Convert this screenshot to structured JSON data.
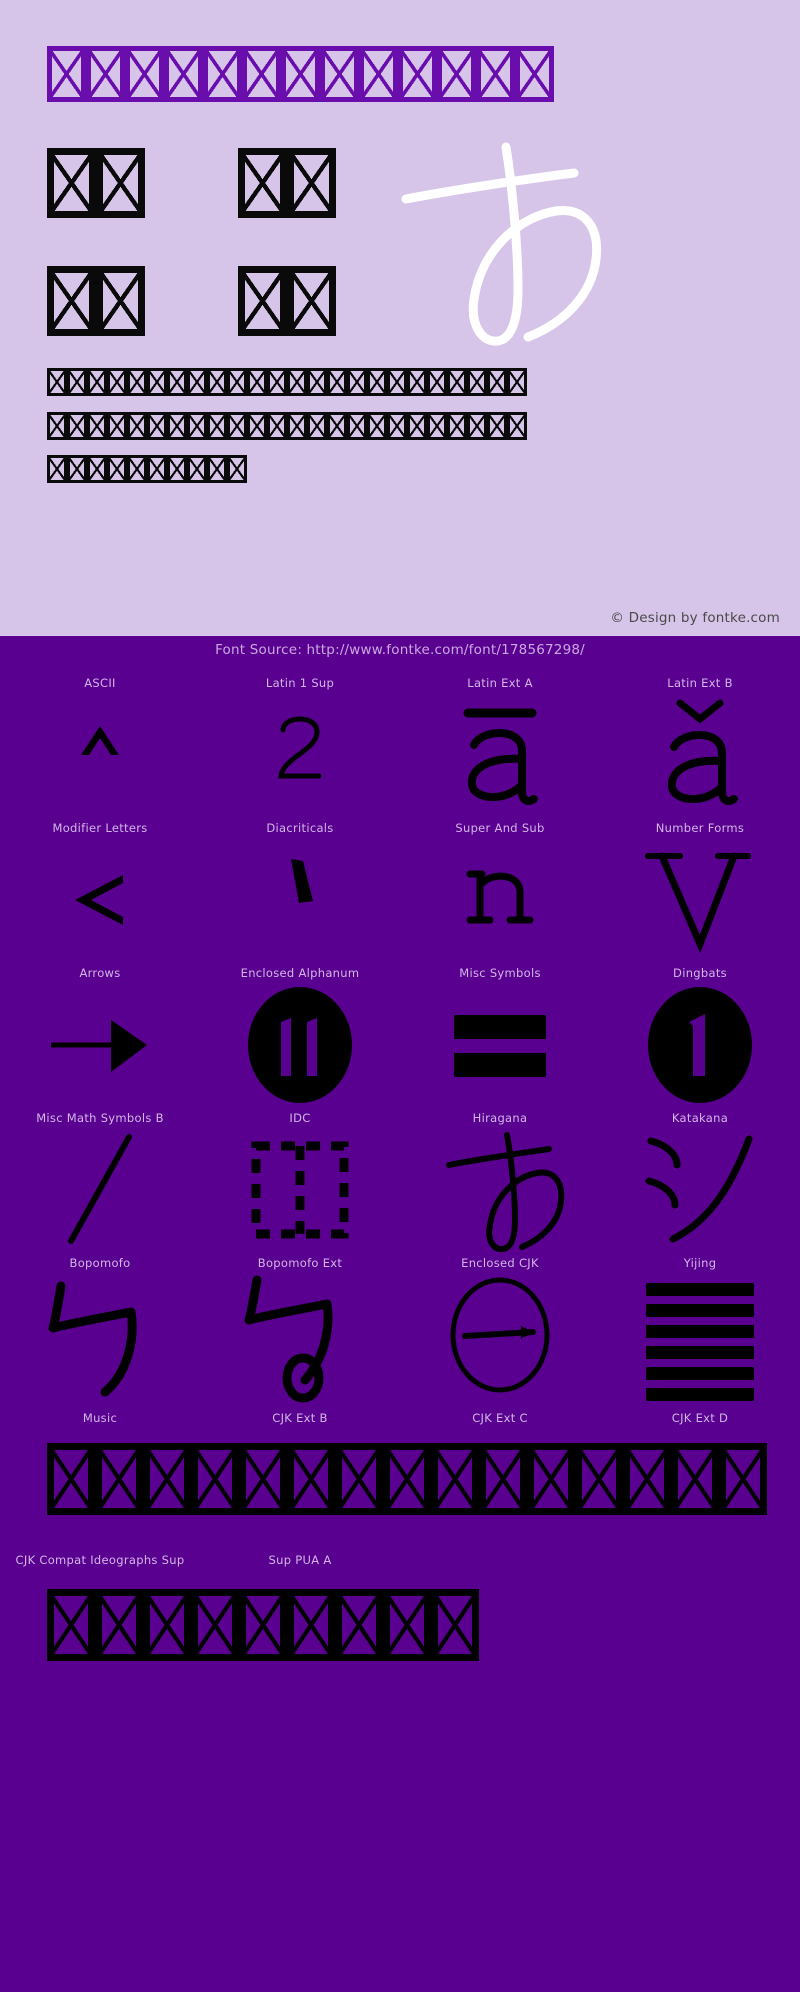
{
  "page": {
    "background_light": "#D6C4E9",
    "background_dark": "#5A0091",
    "accent_purple": "#6A0DAD",
    "label_color": "#D2B6E6"
  },
  "specimen": {
    "title_boxes": 13,
    "word_groups": [
      2,
      2,
      2,
      2
    ],
    "body_lines": [
      24,
      24,
      10
    ],
    "showcase_glyph": "あ",
    "copyright": "© Design by fontke.com"
  },
  "source": {
    "text": "Font Source: http://www.fontke.com/font/178567298/"
  },
  "blocks": {
    "rows": [
      [
        {
          "label": "ASCII",
          "glyph": "^"
        },
        {
          "label": "Latin 1 Sup",
          "glyph": "2"
        },
        {
          "label": "Latin Ext A",
          "glyph": "ā"
        },
        {
          "label": "Latin Ext B",
          "glyph": "ǎ"
        }
      ],
      [
        {
          "label": "Modifier Letters",
          "glyph": "<"
        },
        {
          "label": "Diacriticals",
          "glyph": "`"
        },
        {
          "label": "Super And Sub",
          "glyph": "n"
        },
        {
          "label": "Number Forms",
          "glyph": "V"
        }
      ],
      [
        {
          "label": "Arrows",
          "glyph": "→"
        },
        {
          "label": "Enclosed Alphanum",
          "glyph": "⑪"
        },
        {
          "label": "Misc Symbols",
          "glyph": "▤"
        },
        {
          "label": "Dingbats",
          "glyph": "❶"
        }
      ],
      [
        {
          "label": "Misc Math Symbols B",
          "glyph": "╱"
        },
        {
          "label": "IDC",
          "glyph": "⿰"
        },
        {
          "label": "Hiragana",
          "glyph": "あ"
        },
        {
          "label": "Katakana",
          "glyph": "シ"
        }
      ],
      [
        {
          "label": "Bopomofo",
          "glyph": "ㄅ"
        },
        {
          "label": "Bopomofo Ext",
          "glyph": "ㆠ"
        },
        {
          "label": "Enclosed CJK",
          "glyph": "㊀"
        },
        {
          "label": "Yijing",
          "glyph": "䷀"
        }
      ]
    ],
    "strip_rows": [
      {
        "labels": [
          "Music",
          "CJK Ext B",
          "CJK Ext C",
          "CJK Ext D"
        ],
        "boxes": 15
      },
      {
        "labels": [
          "CJK Compat Ideographs Sup",
          "Sup PUA A"
        ],
        "boxes": 9
      }
    ]
  }
}
